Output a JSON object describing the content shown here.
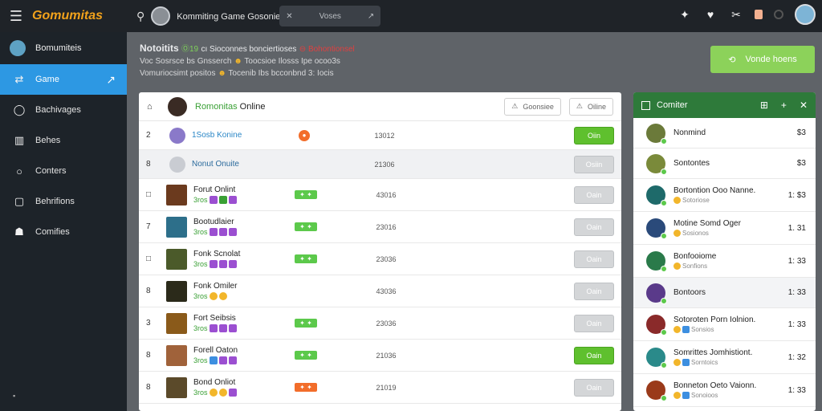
{
  "topbar": {
    "logo": "Gomumitas",
    "title": "Kommiting Game  Gosonie ▾",
    "search_label": "Voses"
  },
  "sidebar": {
    "user": "Bomumiteis",
    "items": [
      {
        "label": "Game",
        "icon": "share-icon",
        "active": true
      },
      {
        "label": "Bachivages",
        "icon": "chat-icon"
      },
      {
        "label": "Behes",
        "icon": "bars-icon"
      },
      {
        "label": "Conters",
        "icon": "circle-icon"
      },
      {
        "label": "Behrifions",
        "icon": "page-icon"
      },
      {
        "label": "Comifies",
        "icon": "users-icon"
      }
    ]
  },
  "notice": {
    "title": "Notoitits",
    "title_green": "Ⓞ19",
    "title_mid": "cı Sioconnes bonciertioses",
    "title_red": "⊖ Bohontionsel",
    "line1_a": "Voc Sosrsce bs Gnsserch",
    "line1_b": "Toocsioe Ilosss Ipe ocoo3s",
    "line2_a": "Vomuriocsimt positos",
    "line2_b": "Tocenib Ibs bcconbnd 3: Iocis"
  },
  "invite_button": "Vonde hoens",
  "main": {
    "header_title_a": "Romonitas",
    "header_title_b": "Online",
    "header_btn1": "Goonsiee",
    "header_btn2": "Oiline",
    "rows": [
      {
        "num": "2",
        "name": "1Sosb Konine",
        "score": "13012",
        "action": "Oiin",
        "action_green": true,
        "style": "first"
      },
      {
        "num": "8",
        "name": "Nonut Onuite",
        "score": "21306",
        "action": "Osiin",
        "action_green": false,
        "style": "second"
      },
      {
        "num": "□",
        "name": "Forut Onlint",
        "count": "3ros",
        "score": "43016",
        "action": "Oain",
        "action_green": false
      },
      {
        "num": "7",
        "name": "Bootudlaier",
        "count": "3ros",
        "score": "23016",
        "action": "Oain",
        "action_green": false
      },
      {
        "num": "□",
        "name": "Fonk Scnolat",
        "count": "3ros",
        "score": "23036",
        "action": "Oain",
        "action_green": false
      },
      {
        "num": "8",
        "name": "Fonk Omiler",
        "count": "3ros",
        "score": "43036",
        "action": "Oain",
        "action_green": false
      },
      {
        "num": "3",
        "name": "Fort Seibsis",
        "count": "3ros",
        "score": "23036",
        "action": "Oain",
        "action_green": false
      },
      {
        "num": "8",
        "name": "Forell Oaton",
        "count": "3ros",
        "score": "21036",
        "action": "Oain",
        "action_green": true
      },
      {
        "num": "8",
        "name": "Bond Onliot",
        "count": "3ros",
        "score": "21019",
        "action": "Oain",
        "action_green": false
      }
    ]
  },
  "friends": {
    "title": "Comiter",
    "items": [
      {
        "name": "Nonmind",
        "value": "  $3",
        "status": ""
      },
      {
        "name": "Sontontes",
        "value": "  $3",
        "status": ""
      },
      {
        "name": "Bortontion Ooo Nanne.",
        "value": "1: $3",
        "status": "Sotoriose"
      },
      {
        "name": "Motine Somd Oger",
        "value": "1. 31",
        "status": "Sosionos"
      },
      {
        "name": "Bonfooiome",
        "value": "1: 33",
        "status": "Sonfions"
      },
      {
        "name": "Bontoors",
        "value": "1: 33",
        "status": ""
      },
      {
        "name": "Sotoroten Porn Iolnion.",
        "value": "1: 33",
        "status": "Sonsios"
      },
      {
        "name": "Somrittes Jomhistiont.",
        "value": "1: 32",
        "status": "Sorntoics"
      },
      {
        "name": "Bonneton Oeto Vaionn.",
        "value": "1: 33",
        "status": "Sonoioos"
      }
    ]
  },
  "colors": {
    "accent": "#2d98e3",
    "online_green": "#5cc94b",
    "invite_green": "#8cd25a",
    "friends_header": "#2e7a3a",
    "logo_orange": "#f2a21b"
  }
}
